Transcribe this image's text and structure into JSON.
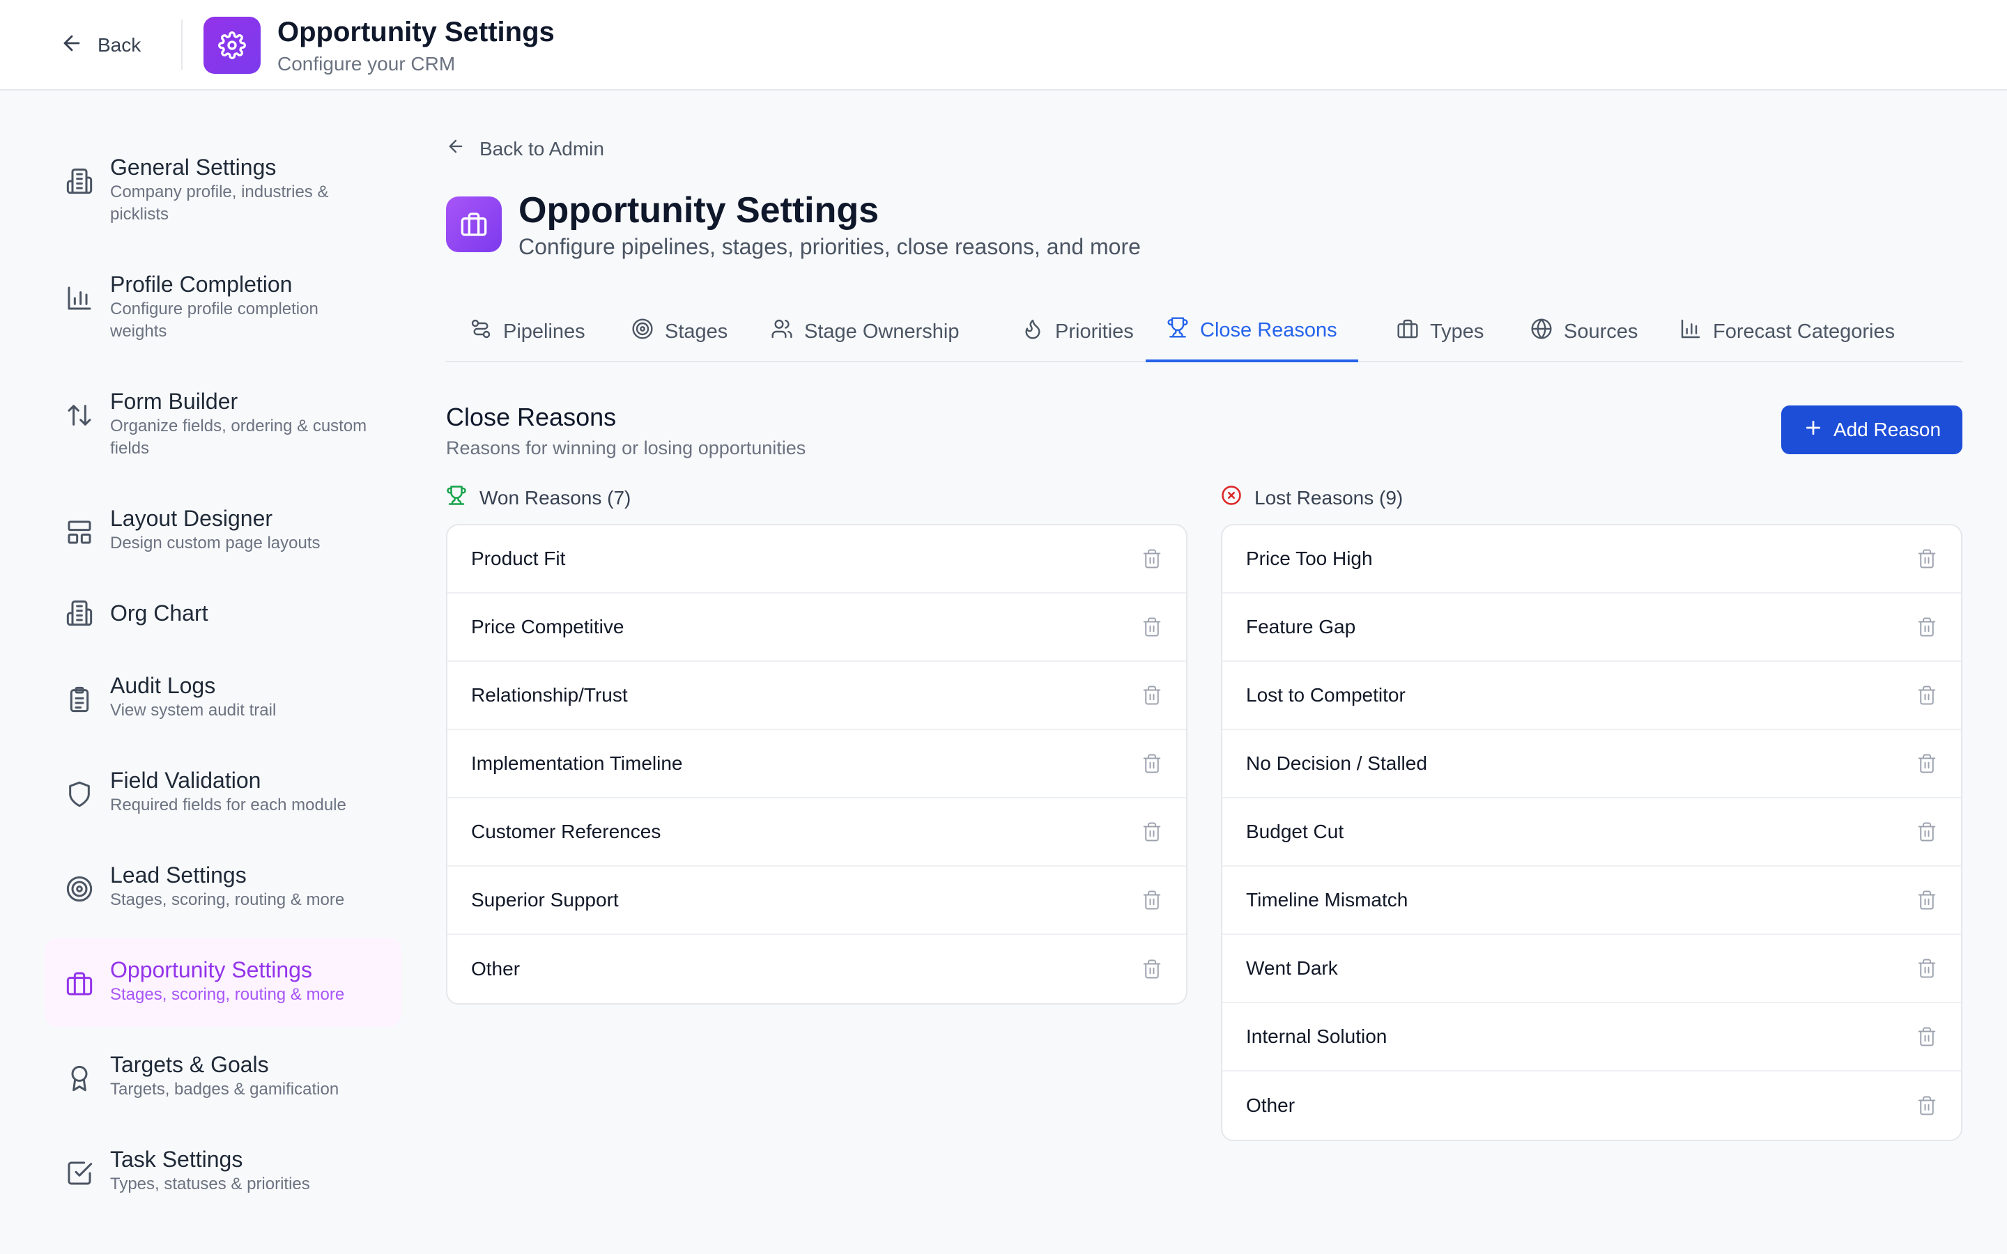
{
  "topbar": {
    "back_label": "Back",
    "title": "Opportunity Settings",
    "subtitle": "Configure your CRM"
  },
  "sidebar": {
    "items": [
      {
        "label": "General Settings",
        "desc": "Company profile, industries & picklists",
        "icon": "building-icon"
      },
      {
        "label": "Profile Completion",
        "desc": "Configure profile completion weights",
        "icon": "bar-chart-icon"
      },
      {
        "label": "Form Builder",
        "desc": "Organize fields, ordering & custom fields",
        "icon": "sort-arrows-icon"
      },
      {
        "label": "Layout Designer",
        "desc": "Design custom page layouts",
        "icon": "layout-icon"
      },
      {
        "label": "Org Chart",
        "desc": "",
        "icon": "building-icon"
      },
      {
        "label": "Audit Logs",
        "desc": "View system audit trail",
        "icon": "clipboard-icon"
      },
      {
        "label": "Field Validation",
        "desc": "Required fields for each module",
        "icon": "shield-icon"
      },
      {
        "label": "Lead Settings",
        "desc": "Stages, scoring, routing & more",
        "icon": "target-icon"
      },
      {
        "label": "Opportunity Settings",
        "desc": "Stages, scoring, routing & more",
        "icon": "briefcase-icon",
        "active": true
      },
      {
        "label": "Targets & Goals",
        "desc": "Targets, badges & gamification",
        "icon": "award-icon"
      },
      {
        "label": "Task Settings",
        "desc": "Types, statuses & priorities",
        "icon": "checkbox-icon"
      }
    ]
  },
  "main": {
    "back_label": "Back to Admin",
    "title": "Opportunity Settings",
    "subtitle": "Configure pipelines, stages, priorities, close reasons, and more",
    "tabs": [
      {
        "label": "Pipelines",
        "icon": "pipeline-icon"
      },
      {
        "label": "Stages",
        "icon": "target-icon"
      },
      {
        "label": "Stage Ownership",
        "icon": "users-icon"
      },
      {
        "label": "Priorities",
        "icon": "flame-icon"
      },
      {
        "label": "Close Reasons",
        "icon": "trophy-icon",
        "active": true
      },
      {
        "label": "Types",
        "icon": "briefcase-icon"
      },
      {
        "label": "Sources",
        "icon": "globe-icon"
      },
      {
        "label": "Forecast Categories",
        "icon": "bar-chart-icon"
      }
    ],
    "section_title": "Close Reasons",
    "section_desc": "Reasons for winning or losing opportunities",
    "add_button": "Add Reason",
    "won": {
      "heading": "Won Reasons (7)",
      "items": [
        "Product Fit",
        "Price Competitive",
        "Relationship/Trust",
        "Implementation Timeline",
        "Customer References",
        "Superior Support",
        "Other"
      ]
    },
    "lost": {
      "heading": "Lost Reasons (9)",
      "items": [
        "Price Too High",
        "Feature Gap",
        "Lost to Competitor",
        "No Decision / Stalled",
        "Budget Cut",
        "Timeline Mismatch",
        "Went Dark",
        "Internal Solution",
        "Other"
      ]
    }
  },
  "colors": {
    "accent": "#2563eb",
    "brand_purple": "#9333ea",
    "won_green": "#16a34a",
    "lost_red": "#dc2626"
  }
}
